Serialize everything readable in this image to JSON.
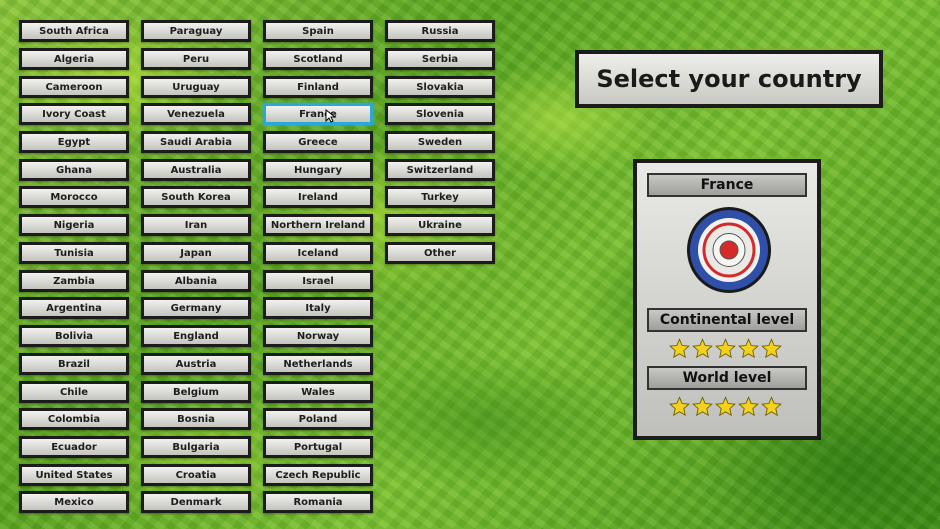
{
  "countries": {
    "col1": [
      "South Africa",
      "Algeria",
      "Cameroon",
      "Ivory Coast",
      "Egypt",
      "Ghana",
      "Morocco",
      "Nigeria",
      "Tunisia",
      "Zambia",
      "Argentina",
      "Bolivia",
      "Brazil",
      "Chile",
      "Colombia",
      "Ecuador",
      "United States",
      "Mexico"
    ],
    "col2": [
      "Paraguay",
      "Peru",
      "Uruguay",
      "Venezuela",
      "Saudi Arabia",
      "Australia",
      "South Korea",
      "Iran",
      "Japan",
      "Albania",
      "Germany",
      "England",
      "Austria",
      "Belgium",
      "Bosnia",
      "Bulgaria",
      "Croatia",
      "Denmark"
    ],
    "col3": [
      "Spain",
      "Scotland",
      "Finland",
      "France",
      "Greece",
      "Hungary",
      "Ireland",
      "Northern Ireland",
      "Iceland",
      "Israel",
      "Italy",
      "Norway",
      "Netherlands",
      "Wales",
      "Poland",
      "Portugal",
      "Czech Republic",
      "Romania"
    ],
    "col4": [
      "Russia",
      "Serbia",
      "Slovakia",
      "Slovenia",
      "Sweden",
      "Switzerland",
      "Turkey",
      "Ukraine",
      "Other"
    ]
  },
  "selected_country": "France",
  "title": "Select your country",
  "panel": {
    "country": "France",
    "continental_label": "Continental level",
    "continental_stars": 5,
    "world_label": "World level",
    "world_stars": 5
  },
  "colors": {
    "selected_border": "#2aa8d6",
    "emblem_blue": "#2f4fa8",
    "emblem_red": "#d42a2a",
    "star_gold": "#f2d21c"
  }
}
